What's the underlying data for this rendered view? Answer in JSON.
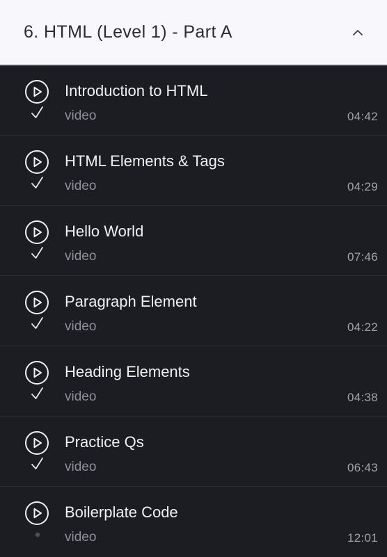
{
  "section": {
    "title": "6. HTML (Level 1) - Part A",
    "toggle_icon": "chevron-up-icon"
  },
  "colors": {
    "header_bg": "#f8f8fc",
    "list_bg": "#1c1d22",
    "title_text": "#f1f1f4",
    "muted_text": "#8f9099"
  },
  "lectures": [
    {
      "title": "Introduction to HTML",
      "type": "video",
      "duration": "04:42",
      "status": "completed",
      "status_icon": "check-icon"
    },
    {
      "title": "HTML Elements & Tags",
      "type": "video",
      "duration": "04:29",
      "status": "completed",
      "status_icon": "check-icon"
    },
    {
      "title": "Hello World",
      "type": "video",
      "duration": "07:46",
      "status": "completed",
      "status_icon": "check-icon"
    },
    {
      "title": "Paragraph Element",
      "type": "video",
      "duration": "04:22",
      "status": "completed",
      "status_icon": "check-icon"
    },
    {
      "title": "Heading Elements",
      "type": "video",
      "duration": "04:38",
      "status": "completed",
      "status_icon": "check-icon"
    },
    {
      "title": "Practice Qs",
      "type": "video",
      "duration": "06:43",
      "status": "completed",
      "status_icon": "check-icon"
    },
    {
      "title": "Boilerplate Code",
      "type": "video",
      "duration": "12:01",
      "status": "not-started",
      "status_icon": "dot-icon"
    }
  ]
}
